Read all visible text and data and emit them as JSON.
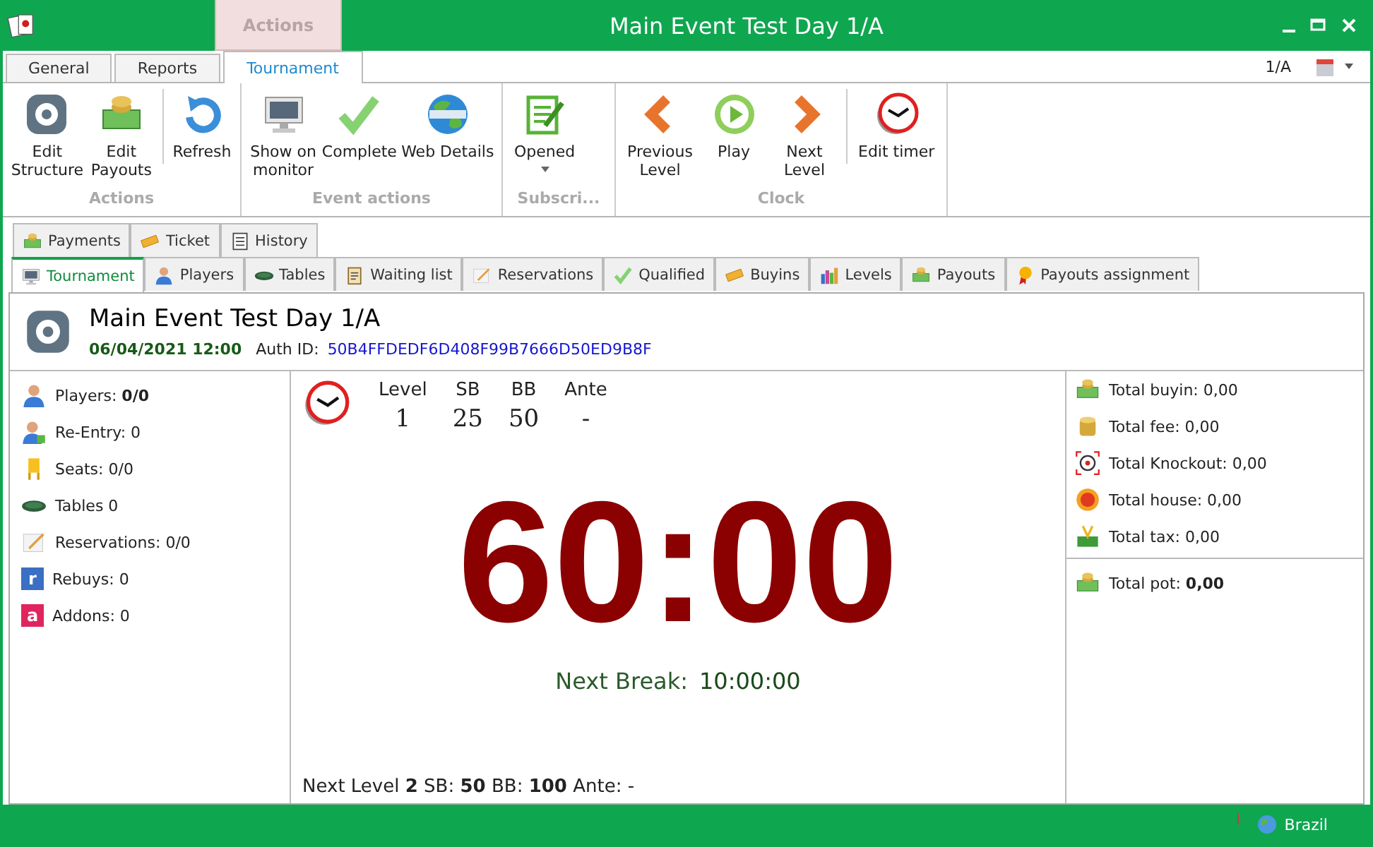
{
  "window": {
    "title": "Main Event Test Day 1/A",
    "context_tab": "Actions"
  },
  "ribbon_tabs": [
    {
      "label": "General",
      "selected": false
    },
    {
      "label": "Reports",
      "selected": false
    },
    {
      "label": "Tournament",
      "selected": true
    }
  ],
  "ribbon_right": {
    "label": "1/A"
  },
  "ribbon_groups": [
    {
      "label": "Actions",
      "items": [
        {
          "label": "Edit\nStructure",
          "separator_before": false,
          "dropdown": false
        },
        {
          "label": "Edit\nPayouts",
          "separator_before": false,
          "dropdown": false
        },
        {
          "label": "Refresh",
          "separator_before": true,
          "dropdown": false
        }
      ]
    },
    {
      "label": "Event actions",
      "items": [
        {
          "label": "Show on\nmonitor",
          "separator_before": false,
          "dropdown": false
        },
        {
          "label": "Complete",
          "separator_before": false,
          "dropdown": false
        },
        {
          "label": "Web Details",
          "separator_before": false,
          "dropdown": false
        }
      ]
    },
    {
      "label": "Subscri...",
      "items": [
        {
          "label": "Opened",
          "separator_before": false,
          "dropdown": true
        }
      ]
    },
    {
      "label": "Clock",
      "items": [
        {
          "label": "Previous\nLevel",
          "separator_before": false,
          "dropdown": false
        },
        {
          "label": "Play",
          "separator_before": false,
          "dropdown": false
        },
        {
          "label": "Next\nLevel",
          "separator_before": false,
          "dropdown": false
        },
        {
          "label": "Edit timer",
          "separator_before": true,
          "dropdown": false
        }
      ]
    }
  ],
  "upper_tabs": [
    {
      "label": "Payments",
      "selected": false
    },
    {
      "label": "Ticket",
      "selected": false
    },
    {
      "label": "History",
      "selected": false
    }
  ],
  "lower_tabs": [
    {
      "label": "Tournament",
      "selected": true
    },
    {
      "label": "Players",
      "selected": false
    },
    {
      "label": "Tables",
      "selected": false
    },
    {
      "label": "Waiting list",
      "selected": false
    },
    {
      "label": "Reservations",
      "selected": false
    },
    {
      "label": "Qualified",
      "selected": false
    },
    {
      "label": "Buyins",
      "selected": false
    },
    {
      "label": "Levels",
      "selected": false
    },
    {
      "label": "Payouts",
      "selected": false
    },
    {
      "label": "Payouts assignment",
      "selected": false
    }
  ],
  "header": {
    "title": "Main Event Test Day 1/A",
    "date": "06/04/2021 12:00",
    "auth_label": "Auth ID:",
    "auth_id": "50B4FFDEDF6D408F99B7666D50ED9B8F"
  },
  "stats": [
    {
      "text": "Players: **0/0**"
    },
    {
      "text": "Re-Entry: 0"
    },
    {
      "text": "Seats: 0/0"
    },
    {
      "text": "Tables 0"
    },
    {
      "text": "Reservations: 0/0"
    },
    {
      "text": "Rebuys: 0",
      "badge": "r",
      "color": "#3a6fc4"
    },
    {
      "text": "Addons: 0",
      "badge": "a",
      "color": "#e0245e"
    }
  ],
  "level_table": {
    "columns": [
      "Level",
      "SB",
      "BB",
      "Ante"
    ],
    "values": [
      "1",
      "25",
      "50",
      "-"
    ]
  },
  "timer": "60:00",
  "next_break": {
    "label": "Next Break:",
    "value": "10:00:00"
  },
  "next_level": "Next Level **2**  SB: **50**  BB: **100**  Ante: -",
  "totals": [
    {
      "text": "Total buyin:  0,00"
    },
    {
      "text": "Total fee:  0,00"
    },
    {
      "text": "Total Knockout:  0,00"
    },
    {
      "text": "Total house:  0,00"
    },
    {
      "text": "Total tax:  0,00"
    }
  ],
  "total_pot": "Total pot:  **0,00**",
  "status_bar": {
    "label": "Brazil"
  }
}
